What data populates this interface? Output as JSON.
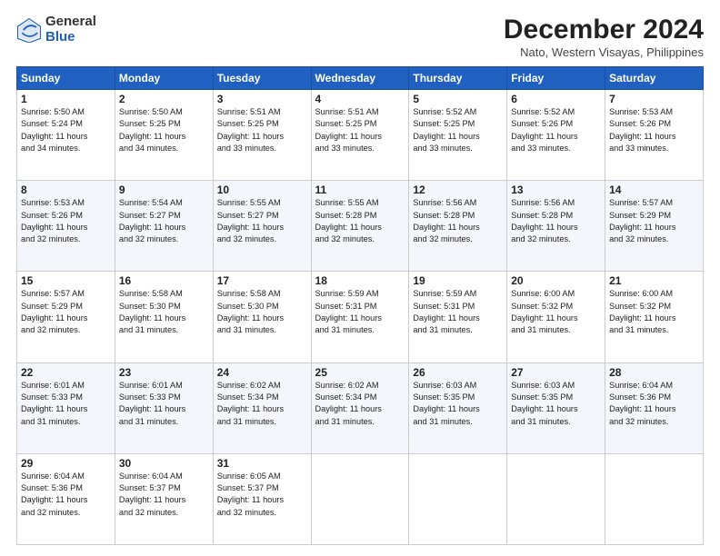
{
  "logo": {
    "general": "General",
    "blue": "Blue"
  },
  "title": "December 2024",
  "subtitle": "Nato, Western Visayas, Philippines",
  "header_days": [
    "Sunday",
    "Monday",
    "Tuesday",
    "Wednesday",
    "Thursday",
    "Friday",
    "Saturday"
  ],
  "weeks": [
    [
      {
        "day": "1",
        "info": "Sunrise: 5:50 AM\nSunset: 5:24 PM\nDaylight: 11 hours\nand 34 minutes."
      },
      {
        "day": "2",
        "info": "Sunrise: 5:50 AM\nSunset: 5:25 PM\nDaylight: 11 hours\nand 34 minutes."
      },
      {
        "day": "3",
        "info": "Sunrise: 5:51 AM\nSunset: 5:25 PM\nDaylight: 11 hours\nand 33 minutes."
      },
      {
        "day": "4",
        "info": "Sunrise: 5:51 AM\nSunset: 5:25 PM\nDaylight: 11 hours\nand 33 minutes."
      },
      {
        "day": "5",
        "info": "Sunrise: 5:52 AM\nSunset: 5:25 PM\nDaylight: 11 hours\nand 33 minutes."
      },
      {
        "day": "6",
        "info": "Sunrise: 5:52 AM\nSunset: 5:26 PM\nDaylight: 11 hours\nand 33 minutes."
      },
      {
        "day": "7",
        "info": "Sunrise: 5:53 AM\nSunset: 5:26 PM\nDaylight: 11 hours\nand 33 minutes."
      }
    ],
    [
      {
        "day": "8",
        "info": "Sunrise: 5:53 AM\nSunset: 5:26 PM\nDaylight: 11 hours\nand 32 minutes."
      },
      {
        "day": "9",
        "info": "Sunrise: 5:54 AM\nSunset: 5:27 PM\nDaylight: 11 hours\nand 32 minutes."
      },
      {
        "day": "10",
        "info": "Sunrise: 5:55 AM\nSunset: 5:27 PM\nDaylight: 11 hours\nand 32 minutes."
      },
      {
        "day": "11",
        "info": "Sunrise: 5:55 AM\nSunset: 5:28 PM\nDaylight: 11 hours\nand 32 minutes."
      },
      {
        "day": "12",
        "info": "Sunrise: 5:56 AM\nSunset: 5:28 PM\nDaylight: 11 hours\nand 32 minutes."
      },
      {
        "day": "13",
        "info": "Sunrise: 5:56 AM\nSunset: 5:28 PM\nDaylight: 11 hours\nand 32 minutes."
      },
      {
        "day": "14",
        "info": "Sunrise: 5:57 AM\nSunset: 5:29 PM\nDaylight: 11 hours\nand 32 minutes."
      }
    ],
    [
      {
        "day": "15",
        "info": "Sunrise: 5:57 AM\nSunset: 5:29 PM\nDaylight: 11 hours\nand 32 minutes."
      },
      {
        "day": "16",
        "info": "Sunrise: 5:58 AM\nSunset: 5:30 PM\nDaylight: 11 hours\nand 31 minutes."
      },
      {
        "day": "17",
        "info": "Sunrise: 5:58 AM\nSunset: 5:30 PM\nDaylight: 11 hours\nand 31 minutes."
      },
      {
        "day": "18",
        "info": "Sunrise: 5:59 AM\nSunset: 5:31 PM\nDaylight: 11 hours\nand 31 minutes."
      },
      {
        "day": "19",
        "info": "Sunrise: 5:59 AM\nSunset: 5:31 PM\nDaylight: 11 hours\nand 31 minutes."
      },
      {
        "day": "20",
        "info": "Sunrise: 6:00 AM\nSunset: 5:32 PM\nDaylight: 11 hours\nand 31 minutes."
      },
      {
        "day": "21",
        "info": "Sunrise: 6:00 AM\nSunset: 5:32 PM\nDaylight: 11 hours\nand 31 minutes."
      }
    ],
    [
      {
        "day": "22",
        "info": "Sunrise: 6:01 AM\nSunset: 5:33 PM\nDaylight: 11 hours\nand 31 minutes."
      },
      {
        "day": "23",
        "info": "Sunrise: 6:01 AM\nSunset: 5:33 PM\nDaylight: 11 hours\nand 31 minutes."
      },
      {
        "day": "24",
        "info": "Sunrise: 6:02 AM\nSunset: 5:34 PM\nDaylight: 11 hours\nand 31 minutes."
      },
      {
        "day": "25",
        "info": "Sunrise: 6:02 AM\nSunset: 5:34 PM\nDaylight: 11 hours\nand 31 minutes."
      },
      {
        "day": "26",
        "info": "Sunrise: 6:03 AM\nSunset: 5:35 PM\nDaylight: 11 hours\nand 31 minutes."
      },
      {
        "day": "27",
        "info": "Sunrise: 6:03 AM\nSunset: 5:35 PM\nDaylight: 11 hours\nand 31 minutes."
      },
      {
        "day": "28",
        "info": "Sunrise: 6:04 AM\nSunset: 5:36 PM\nDaylight: 11 hours\nand 32 minutes."
      }
    ],
    [
      {
        "day": "29",
        "info": "Sunrise: 6:04 AM\nSunset: 5:36 PM\nDaylight: 11 hours\nand 32 minutes."
      },
      {
        "day": "30",
        "info": "Sunrise: 6:04 AM\nSunset: 5:37 PM\nDaylight: 11 hours\nand 32 minutes."
      },
      {
        "day": "31",
        "info": "Sunrise: 6:05 AM\nSunset: 5:37 PM\nDaylight: 11 hours\nand 32 minutes."
      },
      {
        "day": "",
        "info": ""
      },
      {
        "day": "",
        "info": ""
      },
      {
        "day": "",
        "info": ""
      },
      {
        "day": "",
        "info": ""
      }
    ]
  ]
}
